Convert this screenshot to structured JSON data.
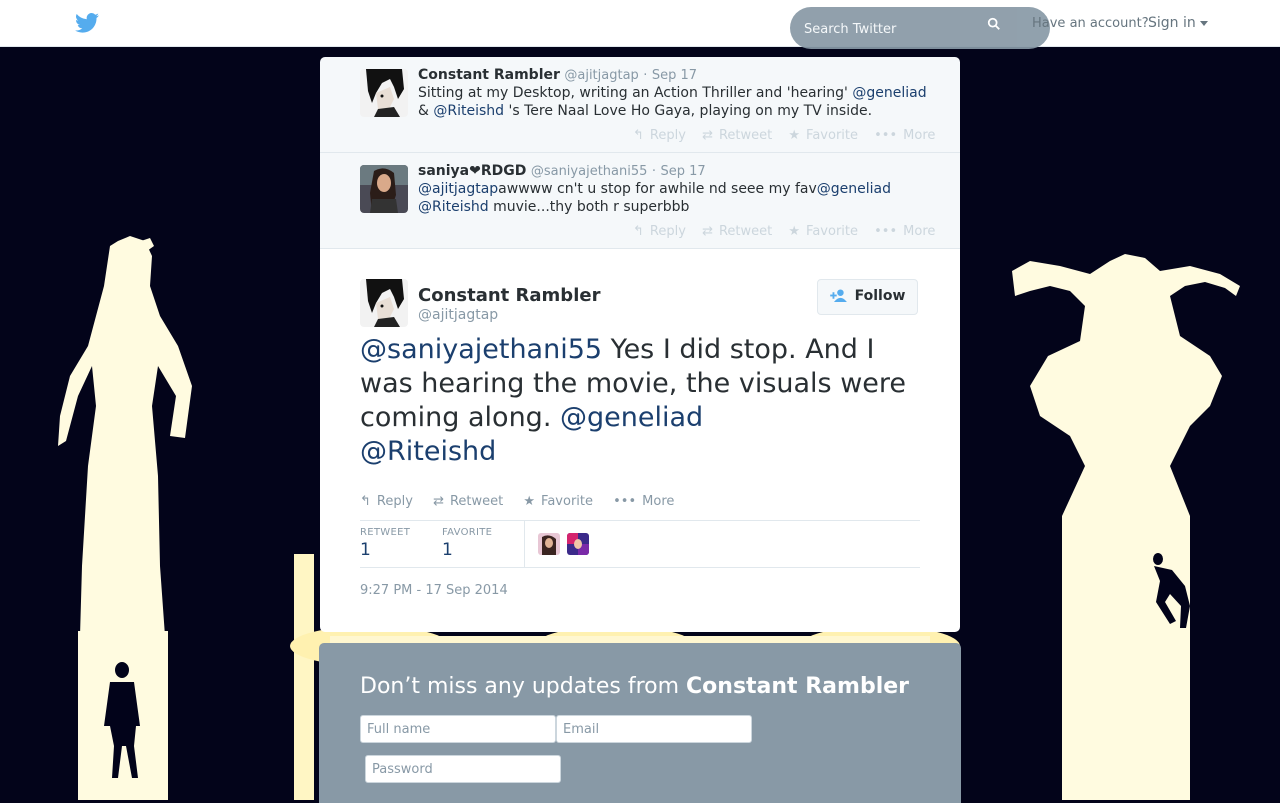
{
  "topbar": {
    "logo": "twitter-bird-icon",
    "search_placeholder": "Search Twitter",
    "have_account": "Have an account?",
    "sign_in": "Sign in"
  },
  "replies": [
    {
      "name": "Constant Rambler",
      "handle": "@ajitjagtap",
      "date": "Sep 17",
      "text_parts": {
        "a": "Sitting at my Desktop, writing an Action Thriller and 'hearing' ",
        "m1": "@geneliad",
        "b": " & ",
        "m2": "@Riteishd",
        "c": " 's Tere Naal Love Ho Gaya, playing on my TV inside."
      }
    },
    {
      "name": "saniya❤RDGD",
      "handle": "@saniyajethani55",
      "date": "Sep 17",
      "text_parts": {
        "m1": "@ajitjagtap",
        "a": "awwww cn't u stop for awhile nd seee my fav",
        "m2": "@geneliad",
        "m3": "@Riteishd",
        "b": " muvie...thy both r superbbb"
      }
    }
  ],
  "actions": {
    "reply": "Reply",
    "retweet": "Retweet",
    "favorite": "Favorite",
    "more": "More"
  },
  "main_tweet": {
    "name": "Constant Rambler",
    "handle": "@ajitjagtap",
    "follow": "Follow",
    "text_parts": {
      "m1": "@saniyajethani55",
      "a": " Yes I did stop. And I was hearing the movie, the visuals were coming along. ",
      "m2": "@geneliad",
      "m3": "@Riteishd"
    },
    "stats": {
      "retweet_label": "RETWEET",
      "retweet_count": "1",
      "favorite_label": "FAVORITE",
      "favorite_count": "1"
    },
    "timestamp": "9:27 PM - 17 Sep 2014"
  },
  "signup": {
    "title_prefix": "Don’t miss any updates from ",
    "title_name": "Constant Rambler",
    "full_name_placeholder": "Full name",
    "email_placeholder": "Email",
    "password_placeholder": "Password"
  },
  "colors": {
    "link": "#1b3f6e",
    "twitter_blue": "#55acee",
    "muted": "#8899a6",
    "background": "#03041a"
  }
}
